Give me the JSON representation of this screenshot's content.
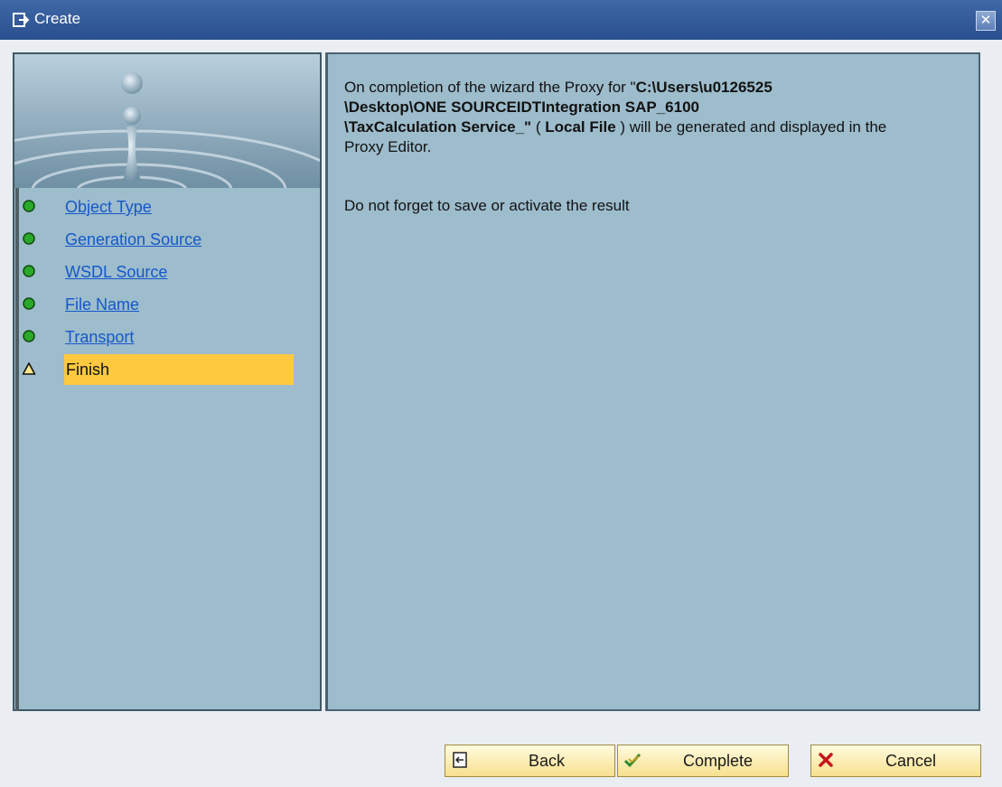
{
  "window": {
    "title": "Create",
    "close_label": "✕"
  },
  "steps": [
    {
      "label": "Object Type",
      "status": "done"
    },
    {
      "label": "Generation Source",
      "status": "done"
    },
    {
      "label": "WSDL Source",
      "status": "done"
    },
    {
      "label": "File Name",
      "status": "done"
    },
    {
      "label": "Transport",
      "status": "done"
    },
    {
      "label": "Finish",
      "status": "current"
    }
  ],
  "message": {
    "intro": "On completion of the wizard the Proxy for \"",
    "path_line1": "C:\\Users\\u0126525",
    "path_line2": "\\Desktop\\ONE SOURCEIDTIntegration SAP_6100",
    "path_line3": "\\TaxCalculation Service_\"",
    "after_path": " ( ",
    "location_type": "Local File",
    "outro": " ) will be generated and displayed in the Proxy Editor.",
    "reminder": "Do not forget to save or activate the result"
  },
  "buttons": {
    "back": "Back",
    "complete": "Complete",
    "cancel": "Cancel"
  },
  "colors": {
    "panel": "#9dbccc",
    "current_step": "#fdc93f",
    "done_dot": "#2aa82a",
    "link": "#1558c9"
  },
  "icons": {
    "title": "window-icon",
    "step_done": "green-circle-icon",
    "step_current": "warning-triangle-icon",
    "back": "back-icon",
    "complete": "check-icon",
    "cancel": "red-x-icon"
  }
}
